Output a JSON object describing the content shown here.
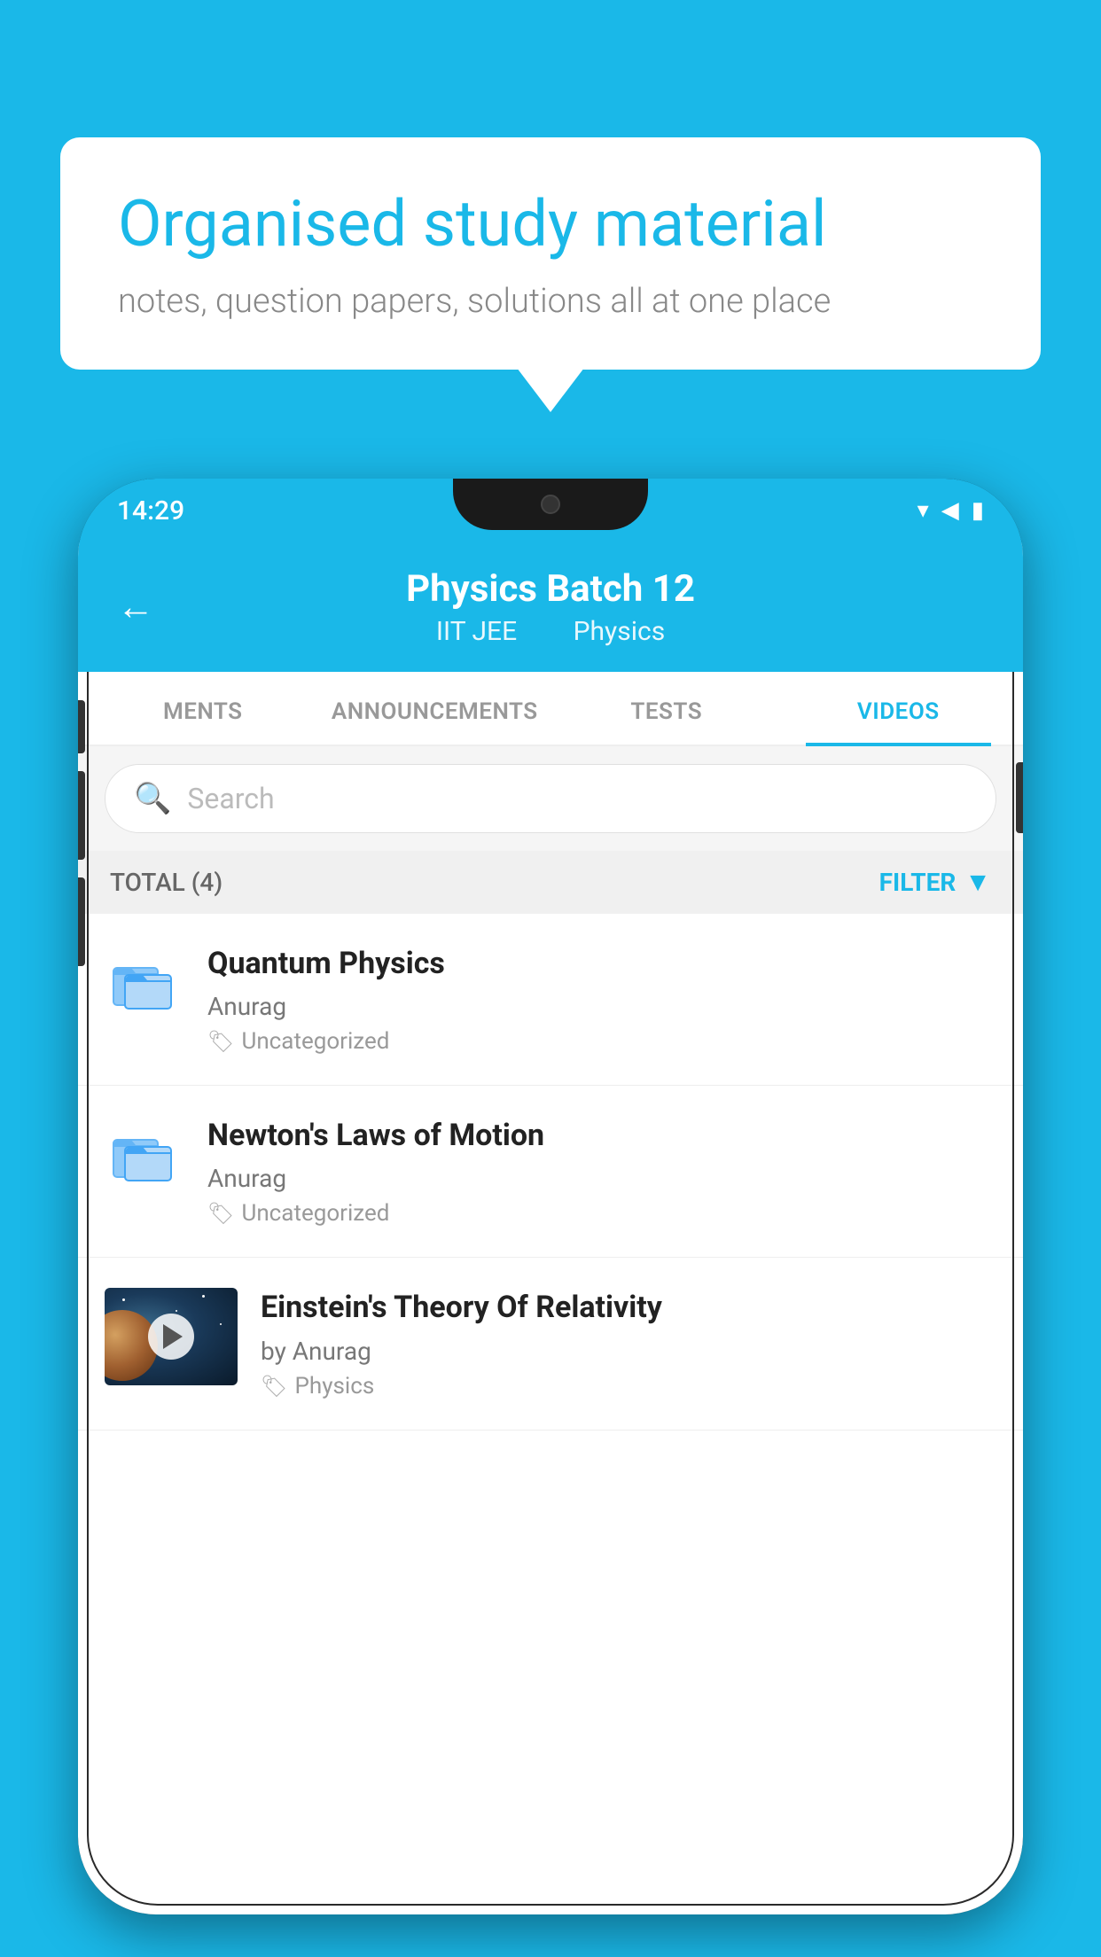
{
  "background": {
    "color": "#1ab8e8"
  },
  "speech_bubble": {
    "title": "Organised study material",
    "subtitle": "notes, question papers, solutions all at one place"
  },
  "phone": {
    "status_bar": {
      "time": "14:29"
    },
    "header": {
      "title": "Physics Batch 12",
      "subtitle_part1": "IIT JEE",
      "subtitle_part2": "Physics",
      "back_label": "←"
    },
    "tabs": [
      {
        "label": "MENTS",
        "active": false
      },
      {
        "label": "ANNOUNCEMENTS",
        "active": false
      },
      {
        "label": "TESTS",
        "active": false
      },
      {
        "label": "VIDEOS",
        "active": true
      }
    ],
    "search": {
      "placeholder": "Search"
    },
    "filter_bar": {
      "total_label": "TOTAL (4)",
      "filter_label": "FILTER"
    },
    "videos": [
      {
        "title": "Quantum Physics",
        "author": "Anurag",
        "tag": "Uncategorized",
        "type": "folder",
        "has_thumb": false
      },
      {
        "title": "Newton's Laws of Motion",
        "author": "Anurag",
        "tag": "Uncategorized",
        "type": "folder",
        "has_thumb": false
      },
      {
        "title": "Einstein's Theory Of Relativity",
        "author": "by Anurag",
        "tag": "Physics",
        "type": "video",
        "has_thumb": true
      }
    ]
  }
}
